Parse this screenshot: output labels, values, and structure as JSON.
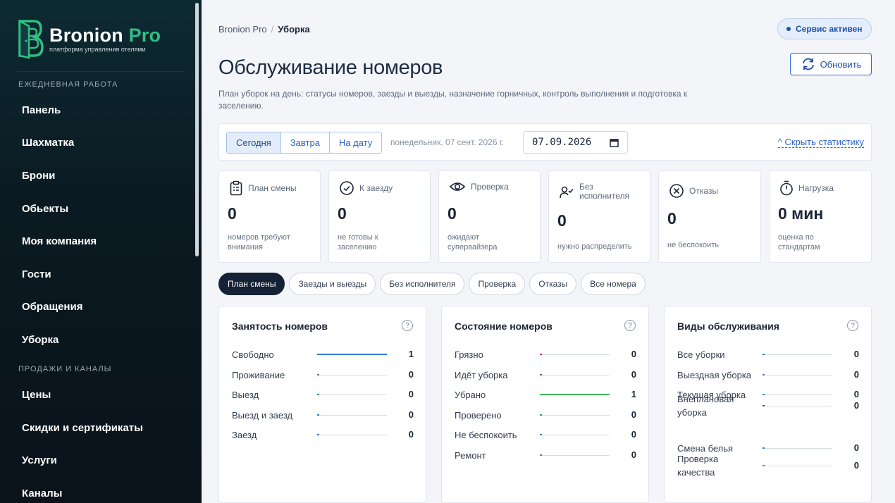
{
  "brand": {
    "name": "Bronion",
    "name_accent": "Pro",
    "tagline": "платформа управления отелями"
  },
  "sidebar": {
    "section_daily": "ЕЖЕДНЕВНАЯ РАБОТА",
    "daily_items": [
      {
        "label": "Панель"
      },
      {
        "label": "Шахматка"
      },
      {
        "label": "Брони"
      },
      {
        "label": "Обьекты"
      },
      {
        "label": "Моя компания"
      },
      {
        "label": "Гости"
      },
      {
        "label": "Обращения"
      },
      {
        "label": "Уборка"
      }
    ],
    "section_sales": "ПРОДАЖИ И КАНАЛЫ",
    "sales_items": [
      {
        "label": "Цены"
      },
      {
        "label": "Скидки и сертификаты"
      },
      {
        "label": "Услуги"
      },
      {
        "label": "Каналы"
      }
    ]
  },
  "header": {
    "breadcrumb_root": "Bronion Pro",
    "breadcrumb_sep": "/",
    "breadcrumb_current": "Уборка",
    "service_status": "Сервис активен",
    "refresh_label": "Обновить",
    "title": "Обслуживание номеров",
    "description": "План уборок на день: статусы номеров, заезды и выезды, назначение горничных, контроль выполнения и подготовка к заселению."
  },
  "datebar": {
    "tabs": [
      {
        "label": "Сегодня"
      },
      {
        "label": "Завтра"
      },
      {
        "label": "На дату"
      }
    ],
    "date_text": "понедельник, 07 сент. 2026 г.",
    "date_value": "07.09.2026",
    "hide_stats": "^ Скрыть статистику"
  },
  "stats": [
    {
      "title": "План смены",
      "value": "0",
      "sub": "номеров требуют внимания",
      "icon": "clipboard-icon"
    },
    {
      "title": "К заезду",
      "value": "0",
      "sub": "не готовы к заселению",
      "icon": "check-circle-icon"
    },
    {
      "title": "Проверка",
      "value": "0",
      "sub": "ожидают супервайзера",
      "icon": "eye-icon"
    },
    {
      "title": "Без исполнителя",
      "value": "0",
      "sub": "нужно распределить",
      "icon": "user-check-icon"
    },
    {
      "title": "Отказы",
      "value": "0",
      "sub": "не беспокоить",
      "icon": "x-circle-icon"
    },
    {
      "title": "Нагрузка",
      "value": "0 мин",
      "sub": "оценка по стандартам",
      "icon": "timer-icon"
    }
  ],
  "filters": [
    {
      "label": "План смены"
    },
    {
      "label": "Заезды и выезды"
    },
    {
      "label": "Без исполнителя"
    },
    {
      "label": "Проверка"
    },
    {
      "label": "Отказы"
    },
    {
      "label": "Все номера"
    }
  ],
  "panels": [
    {
      "title": "Занятость номеров",
      "help": "?",
      "rows": [
        {
          "label": "Свободно",
          "value": "1",
          "fraction": 1.0,
          "color": "#2f7fd1"
        },
        {
          "label": "Проживание",
          "value": "0",
          "fraction": 0,
          "color": "#2f7fd1"
        },
        {
          "label": "Выезд",
          "value": "0",
          "fraction": 0,
          "color": "#2f7fd1"
        },
        {
          "label": "Выезд и заезд",
          "value": "0",
          "fraction": 0,
          "color": "#2f7fd1"
        },
        {
          "label": "Заезд",
          "value": "0",
          "fraction": 0,
          "color": "#2f7fd1"
        }
      ]
    },
    {
      "title": "Состояние номеров",
      "help": "?",
      "rows": [
        {
          "label": "Грязно",
          "value": "0",
          "fraction": 0,
          "color": "#d9364a"
        },
        {
          "label": "Идёт уборка",
          "value": "0",
          "fraction": 0,
          "color": "#8e3bbf"
        },
        {
          "label": "Убрано",
          "value": "1",
          "fraction": 1.0,
          "color": "#3cb85c"
        },
        {
          "label": "Проверено",
          "value": "0",
          "fraction": 0,
          "color": "#2a9d63"
        },
        {
          "label": "Не беспокоить",
          "value": "0",
          "fraction": 0,
          "color": "#2f7fd1"
        },
        {
          "label": "Ремонт",
          "value": "0",
          "fraction": 0,
          "color": "#6c7686"
        }
      ]
    },
    {
      "title": "Виды обслуживания",
      "help": "?",
      "rows": [
        {
          "label": "Все уборки",
          "value": "0",
          "fraction": 0,
          "color": "#2f7fd1"
        },
        {
          "label": "Выездная уборка",
          "value": "0",
          "fraction": 0,
          "color": "#2f7fd1"
        },
        {
          "label": "Текущая уборка",
          "value": "0",
          "fraction": 0,
          "color": "#2f7fd1"
        },
        {
          "label": "Внеплановая уборка",
          "value": "0",
          "fraction": 0,
          "color": "#5a3bbf"
        },
        {
          "label": "Смена белья",
          "value": "0",
          "fraction": 0,
          "color": "#2f7fd1"
        },
        {
          "label": "Проверка качества",
          "value": "0",
          "fraction": 0,
          "color": "#2a9d63"
        }
      ]
    }
  ]
}
